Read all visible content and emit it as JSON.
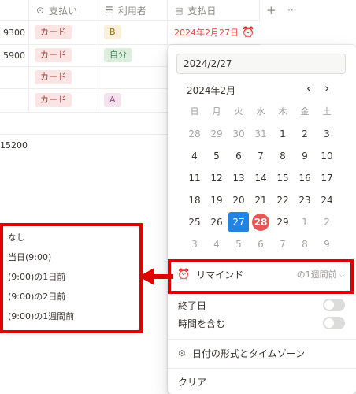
{
  "table": {
    "headers": {
      "payment": "支払い",
      "user": "利用者",
      "paydate": "支払日",
      "add": "+",
      "more": "···"
    },
    "rows": [
      {
        "amount": "9300",
        "payment": "カード",
        "user": "B",
        "date": "2024年2月27日"
      },
      {
        "amount": "5900",
        "payment": "カード",
        "user": "自分"
      },
      {
        "payment": "カード"
      },
      {
        "payment": "カード",
        "user": "A"
      }
    ],
    "total": "15200"
  },
  "datepicker": {
    "input_value": "2024/2/27",
    "month_label": "2024年2月",
    "prev": "‹",
    "next": "›",
    "weekdays": [
      "日",
      "月",
      "火",
      "水",
      "木",
      "金",
      "土"
    ],
    "days": [
      [
        "28",
        "29",
        "30",
        "31",
        "1",
        "2",
        "3"
      ],
      [
        "4",
        "5",
        "6",
        "7",
        "8",
        "9",
        "10"
      ],
      [
        "11",
        "12",
        "13",
        "14",
        "15",
        "16",
        "17"
      ],
      [
        "18",
        "19",
        "20",
        "21",
        "22",
        "23",
        "24"
      ],
      [
        "25",
        "26",
        "27",
        "28",
        "29",
        "1",
        "2"
      ],
      [
        "3",
        "4",
        "5",
        "6",
        "7",
        "8",
        "9"
      ]
    ],
    "remind_label": "リマインド",
    "remind_value": "の1週間前",
    "end_date_label": "終了日",
    "include_time_label": "時間を含む",
    "format_label": "日付の形式とタイムゾーン",
    "clear_label": "クリア"
  },
  "remind_menu": {
    "items": [
      "なし",
      "当日(9:00)",
      "(9:00)の1日前",
      "(9:00)の2日前",
      "(9:00)の1週間前"
    ]
  },
  "colors": {
    "accent": "#2383e2",
    "today": "#eb5757",
    "highlight": "#e00000"
  }
}
